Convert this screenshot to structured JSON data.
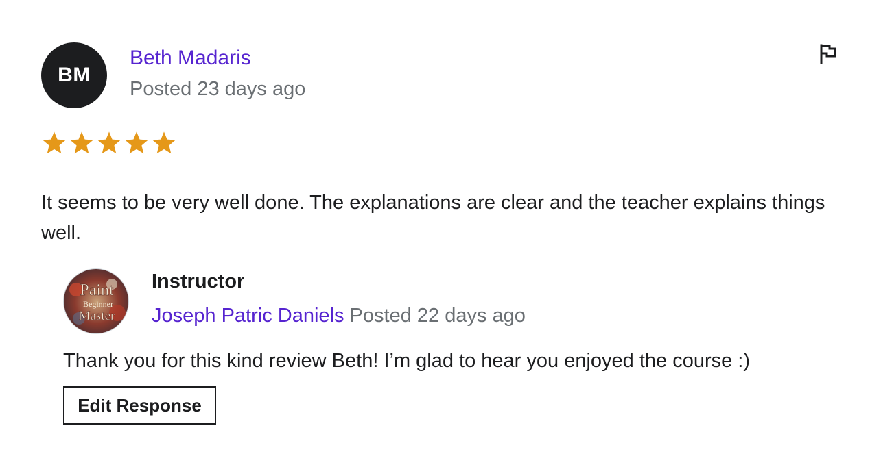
{
  "reviewer": {
    "initials": "BM",
    "name": "Beth Madaris",
    "posted": "Posted 23 days ago",
    "rating": 5,
    "rating_max": 5,
    "text": "It seems to be very well done. The explanations are clear and the teacher explains things well."
  },
  "report": {
    "icon": "flag-icon"
  },
  "response": {
    "role": "Instructor",
    "name": "Joseph Patric Daniels",
    "posted": "Posted 22 days ago",
    "text": "Thank you for this kind review Beth! I’m glad to hear you enjoyed the course :)",
    "avatar_logo_text": [
      "Paint",
      "Beginner",
      "Master"
    ],
    "edit_label": "Edit Response"
  },
  "colors": {
    "link": "#5624d0",
    "muted": "#6a6f73",
    "star": "#e59819",
    "text": "#1c1d1f"
  }
}
